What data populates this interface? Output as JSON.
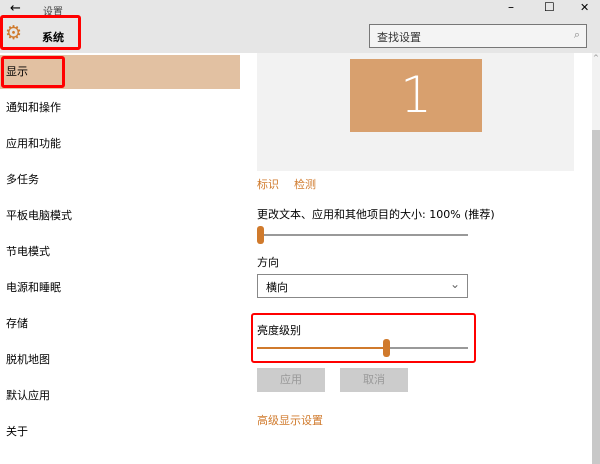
{
  "window": {
    "title": "设置",
    "back_icon": "arrow-left-icon",
    "minimize": "–",
    "maximize": "☐",
    "close": "✕"
  },
  "header": {
    "section_icon": "gear-icon",
    "section_title": "系统",
    "search_placeholder": "查找设置"
  },
  "sidebar": {
    "items": [
      {
        "label": "显示",
        "selected": true
      },
      {
        "label": "通知和操作"
      },
      {
        "label": "应用和功能"
      },
      {
        "label": "多任务"
      },
      {
        "label": "平板电脑模式"
      },
      {
        "label": "节电模式"
      },
      {
        "label": "电源和睡眠"
      },
      {
        "label": "存储"
      },
      {
        "label": "脱机地图"
      },
      {
        "label": "默认应用"
      },
      {
        "label": "关于"
      }
    ]
  },
  "main": {
    "monitor_number": "1",
    "identify_link": "标识",
    "detect_link": "检测",
    "scale_label": "更改文本、应用和其他项目的大小: 100% (推荐)",
    "scale_value": 0,
    "orientation_label": "方向",
    "orientation_value": "横向",
    "brightness_label": "亮度级别",
    "brightness_value": 0.61,
    "apply_button": "应用",
    "cancel_button": "取消",
    "advanced_link": "高级显示设置"
  },
  "colors": {
    "accent": "#d07a2c",
    "selected": "#e2c1a2",
    "monitor": "#d8a06e",
    "highlight": "#ff0000"
  }
}
